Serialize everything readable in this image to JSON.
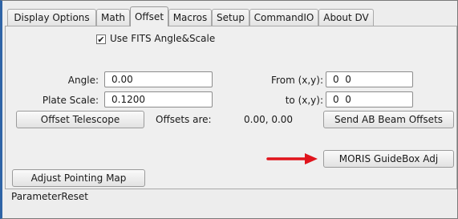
{
  "tabs": [
    {
      "label": "Display Options",
      "active": false
    },
    {
      "label": "Math",
      "active": false
    },
    {
      "label": "Offset",
      "active": true
    },
    {
      "label": "Macros",
      "active": false
    },
    {
      "label": "Setup",
      "active": false
    },
    {
      "label": "CommandIO",
      "active": false
    },
    {
      "label": "About DV",
      "active": false
    }
  ],
  "offset": {
    "use_fits_label": "Use FITS Angle&Scale",
    "use_fits_checked": true,
    "angle_label": "Angle:",
    "angle_value": "0.00",
    "plate_scale_label": "Plate Scale:",
    "plate_scale_value": "0.1200",
    "from_label": "From (x,y):",
    "from_value": "0  0",
    "to_label": "to (x,y):",
    "to_value": "0  0",
    "offset_telescope_button": "Offset Telescope",
    "offsets_are_label": "Offsets are:",
    "offsets_value": "0.00, 0.00",
    "send_ab_button": "Send AB Beam Offsets",
    "moris_button": "MORIS GuideBox Adj",
    "adjust_pointing_button": "Adjust Pointing Map"
  },
  "status": {
    "text": "ParameterReset"
  },
  "colors": {
    "arrow": "#e0141c",
    "window_accent": "#2f64a6"
  },
  "icons": {
    "checkbox": "check-icon",
    "annotation": "arrow-right-icon"
  }
}
